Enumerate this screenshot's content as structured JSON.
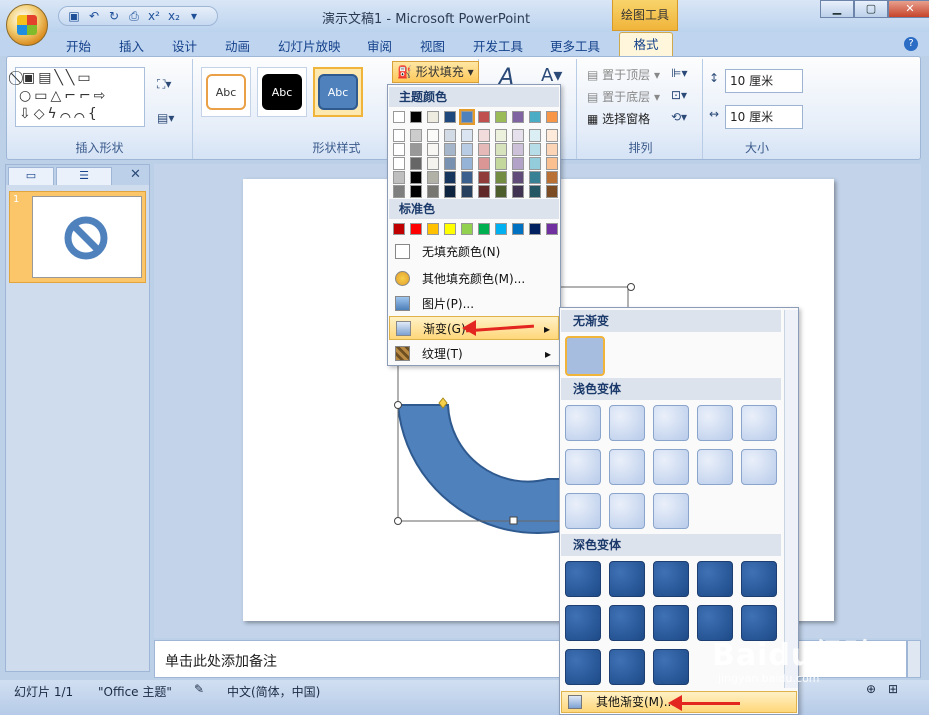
{
  "window": {
    "title": "演示文稿1 - Microsoft PowerPoint",
    "context_tool": "绘图工具",
    "min": "▁",
    "max": "▢",
    "close": "✕"
  },
  "tabs": [
    "开始",
    "插入",
    "设计",
    "动画",
    "幻灯片放映",
    "审阅",
    "视图",
    "开发工具",
    "更多工具",
    "格式"
  ],
  "ribbon": {
    "groups": {
      "insert_shapes": "插入形状",
      "shape_styles": "形状样式",
      "arrange": "排列",
      "size": "大小"
    },
    "style_sample": "Abc",
    "fill_button": "形状填充",
    "bring_front": "置于顶层",
    "send_back": "置于底层",
    "selection_pane": "选择窗格",
    "height_value": "10 厘米",
    "width_value": "10 厘米",
    "shape_glyphs": "⃠▣▤╲╲▭ ○▭△⌐⌐⇨ ⇩◇ϟ⌒⌒{"
  },
  "fill_menu": {
    "theme_colors": "主题颜色",
    "standard_colors": "标准色",
    "no_fill": "无填充颜色(N)",
    "more_colors": "其他填充颜色(M)...",
    "picture": "图片(P)...",
    "gradient": "渐变(G)",
    "texture": "纹理(T)",
    "theme_top": [
      "#ffffff",
      "#000000",
      "#eeece1",
      "#1f497d",
      "#4f81bd",
      "#c0504d",
      "#9bbb59",
      "#8064a2",
      "#4bacc6",
      "#f79646"
    ],
    "standard": [
      "#c00000",
      "#ff0000",
      "#ffc000",
      "#ffff00",
      "#92d050",
      "#00b050",
      "#00b0f0",
      "#0070c0",
      "#002060",
      "#7030a0"
    ]
  },
  "gradient_menu": {
    "no_gradient": "无渐变",
    "light": "浅色变体",
    "dark": "深色变体",
    "more": "其他渐变(M)..."
  },
  "leftpane": {
    "slide_number": "1",
    "close": "✕"
  },
  "notes": {
    "placeholder": "单击此处添加备注"
  },
  "status": {
    "slide": "幻灯片 1/1",
    "theme": "\"Office 主题\"",
    "language": "中文(简体，中国)"
  },
  "watermark": {
    "main": "Baidu经验",
    "sub": "jingyan.baidu.com"
  },
  "colors": {
    "accent": "#ffc85a",
    "shape_blue": "#4f81bd",
    "arrow": "#e3261f"
  }
}
